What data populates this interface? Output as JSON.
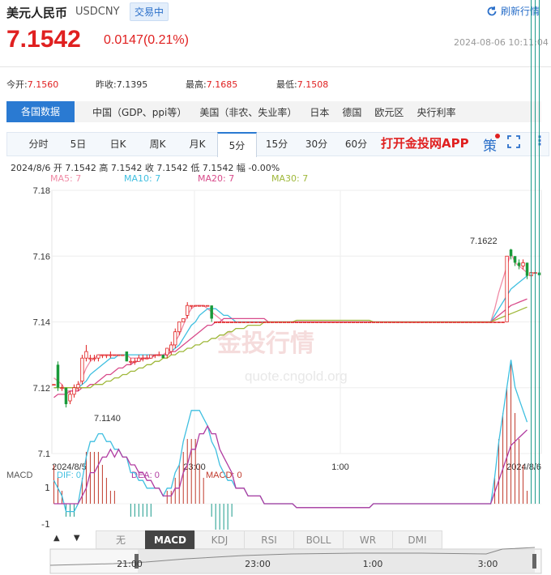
{
  "header": {
    "name": "美元人民币",
    "code": "USDCNY",
    "status": "交易中",
    "refresh_label": "刷新行情",
    "price": "7.1542",
    "change": "0.0147(0.21%)",
    "timestamp": "2024-08-06 10:11:04"
  },
  "stats": [
    {
      "label": "今开:",
      "value": "7.1560"
    },
    {
      "label": "昨收:",
      "value": "7.1395"
    },
    {
      "label": "最高:",
      "value": "7.1685"
    },
    {
      "label": "最低:",
      "value": "7.1508"
    }
  ],
  "data_tabs": [
    "各国数据",
    "中国（GDP、ppi等）",
    "美国（非农、失业率）",
    "日本",
    "德国",
    "欧元区",
    "央行利率"
  ],
  "period_tabs": [
    "分时",
    "5日",
    "日K",
    "周K",
    "月K",
    "5分",
    "15分",
    "30分",
    "60分"
  ],
  "active_period": "5分",
  "app_link": "打开金投网APP",
  "ce_label": "策",
  "info_line": "2024/8/6  开 7.1542  高 7.1542  收 7.1542  低 7.1542  幅 -0.00%",
  "ma": [
    {
      "label": "MA5: 7",
      "color": "#f08aa5"
    },
    {
      "label": "MA10: 7",
      "color": "#3fbfe0"
    },
    {
      "label": "MA20: 7",
      "color": "#d84a8a"
    },
    {
      "label": "MA30: 7",
      "color": "#9fb83a"
    }
  ],
  "watermark": {
    "cn": "金投行情",
    "url": "quote.cngold.org"
  },
  "macd_legend": [
    {
      "label": "MACD",
      "color": "#555"
    },
    {
      "label": "DIF: 0",
      "color": "#3fbfe0"
    },
    {
      "label": "DEA: 0",
      "color": "#b03aa0"
    },
    {
      "label": "MACD: 0",
      "color": "#c0392b"
    }
  ],
  "indicator_tabs": [
    "无",
    "MACD",
    "KDJ",
    "RSI",
    "BOLL",
    "WR",
    "DMI"
  ],
  "active_indicator": "MACD",
  "nav_labels": [
    "21:00",
    "23:00",
    "1:00",
    "3:00"
  ],
  "arrows": [
    "▲",
    "▼"
  ],
  "chart_data": {
    "type": "candlestick",
    "ylim": [
      7.1,
      7.18
    ],
    "y_ticks": [
      "7.18",
      "7.16",
      "7.14",
      "7.12",
      "7.1"
    ],
    "x_ticks": [
      "2024/8/5",
      "23:00",
      "1:00",
      "2024/8/6"
    ],
    "annotations": [
      "7.1140",
      "7.1622"
    ],
    "candles": [
      [
        7.121,
        7.121,
        7.12,
        7.12
      ],
      [
        7.127,
        7.12,
        7.128,
        7.119
      ],
      [
        7.12,
        7.12,
        7.121,
        7.119
      ],
      [
        7.12,
        7.115,
        7.12,
        7.114
      ],
      [
        7.116,
        7.118,
        7.119,
        7.115
      ],
      [
        7.118,
        7.12,
        7.121,
        7.117
      ],
      [
        7.12,
        7.121,
        7.122,
        7.119
      ],
      [
        7.122,
        7.129,
        7.13,
        7.121
      ],
      [
        7.129,
        7.131,
        7.133,
        7.128
      ],
      [
        7.129,
        7.129,
        7.13,
        7.128
      ],
      [
        7.129,
        7.129,
        7.13,
        7.128
      ],
      [
        7.129,
        7.13,
        7.13,
        7.128
      ],
      [
        7.13,
        7.13,
        7.13,
        7.129
      ],
      [
        7.13,
        7.13,
        7.13,
        7.129
      ],
      [
        7.13,
        7.13,
        7.131,
        7.129
      ],
      [
        7.13,
        7.13,
        7.13,
        7.13
      ],
      [
        7.13,
        7.13,
        7.13,
        7.13
      ],
      [
        7.13,
        7.13,
        7.13,
        7.13
      ],
      [
        7.131,
        7.128,
        7.131,
        7.128
      ],
      [
        7.128,
        7.128,
        7.129,
        7.127
      ],
      [
        7.128,
        7.128,
        7.129,
        7.127
      ],
      [
        7.128,
        7.129,
        7.13,
        7.128
      ],
      [
        7.129,
        7.129,
        7.13,
        7.128
      ],
      [
        7.129,
        7.129,
        7.13,
        7.129
      ],
      [
        7.129,
        7.13,
        7.13,
        7.129
      ],
      [
        7.13,
        7.13,
        7.13,
        7.129
      ],
      [
        7.13,
        7.13,
        7.131,
        7.13
      ],
      [
        7.13,
        7.129,
        7.13,
        7.129
      ],
      [
        7.13,
        7.132,
        7.132,
        7.129
      ],
      [
        7.131,
        7.133,
        7.134,
        7.13
      ],
      [
        7.133,
        7.137,
        7.138,
        7.132
      ],
      [
        7.137,
        7.14,
        7.14,
        7.136
      ],
      [
        7.14,
        7.141,
        7.141,
        7.14
      ],
      [
        7.142,
        7.145,
        7.146,
        7.141
      ],
      [
        7.145,
        7.145,
        7.145,
        7.144
      ],
      [
        7.145,
        7.145,
        7.145,
        7.145
      ],
      [
        7.145,
        7.145,
        7.145,
        7.145
      ],
      [
        7.145,
        7.145,
        7.145,
        7.145
      ],
      [
        7.145,
        7.145,
        7.145,
        7.145
      ],
      [
        7.145,
        7.141,
        7.145,
        7.14
      ],
      [
        7.14,
        7.14,
        7.14,
        7.14
      ],
      [
        7.14,
        7.14,
        7.14,
        7.14
      ],
      [
        7.14,
        7.14,
        7.14,
        7.14
      ],
      [
        7.14,
        7.14,
        7.14,
        7.14
      ],
      [
        7.14,
        7.14,
        7.14,
        7.14
      ],
      [
        7.14,
        7.14,
        7.14,
        7.14
      ],
      [
        7.14,
        7.14,
        7.14,
        7.14
      ],
      [
        7.14,
        7.14,
        7.14,
        7.14
      ],
      [
        7.14,
        7.14,
        7.14,
        7.14
      ],
      [
        7.14,
        7.14,
        7.14,
        7.14
      ],
      [
        7.14,
        7.14,
        7.14,
        7.14
      ],
      [
        7.14,
        7.14,
        7.14,
        7.14
      ],
      [
        7.14,
        7.14,
        7.14,
        7.14
      ],
      [
        7.14,
        7.14,
        7.14,
        7.14
      ],
      [
        7.14,
        7.14,
        7.14,
        7.14
      ],
      [
        7.14,
        7.14,
        7.14,
        7.14
      ],
      [
        7.14,
        7.14,
        7.14,
        7.14
      ],
      [
        7.14,
        7.14,
        7.14,
        7.14
      ],
      [
        7.14,
        7.14,
        7.14,
        7.14
      ],
      [
        7.14,
        7.14,
        7.14,
        7.14
      ],
      [
        7.14,
        7.14,
        7.14,
        7.14
      ],
      [
        7.14,
        7.14,
        7.14,
        7.14
      ],
      [
        7.14,
        7.14,
        7.14,
        7.14
      ],
      [
        7.14,
        7.14,
        7.14,
        7.14
      ],
      [
        7.14,
        7.14,
        7.14,
        7.14
      ],
      [
        7.14,
        7.14,
        7.14,
        7.14
      ],
      [
        7.14,
        7.14,
        7.14,
        7.14
      ],
      [
        7.14,
        7.14,
        7.14,
        7.14
      ],
      [
        7.14,
        7.14,
        7.14,
        7.14
      ],
      [
        7.14,
        7.14,
        7.14,
        7.14
      ],
      [
        7.14,
        7.14,
        7.14,
        7.14
      ],
      [
        7.14,
        7.14,
        7.14,
        7.14
      ],
      [
        7.14,
        7.14,
        7.14,
        7.14
      ],
      [
        7.14,
        7.14,
        7.14,
        7.14
      ],
      [
        7.14,
        7.14,
        7.14,
        7.14
      ],
      [
        7.14,
        7.14,
        7.14,
        7.14
      ],
      [
        7.14,
        7.14,
        7.14,
        7.14
      ],
      [
        7.14,
        7.14,
        7.14,
        7.14
      ],
      [
        7.14,
        7.14,
        7.14,
        7.14
      ],
      [
        7.14,
        7.14,
        7.14,
        7.14
      ],
      [
        7.14,
        7.14,
        7.14,
        7.14
      ],
      [
        7.14,
        7.14,
        7.14,
        7.14
      ],
      [
        7.14,
        7.14,
        7.14,
        7.14
      ],
      [
        7.14,
        7.14,
        7.14,
        7.14
      ],
      [
        7.14,
        7.14,
        7.14,
        7.14
      ],
      [
        7.14,
        7.14,
        7.14,
        7.14
      ],
      [
        7.14,
        7.14,
        7.14,
        7.14
      ],
      [
        7.14,
        7.14,
        7.14,
        7.14
      ],
      [
        7.14,
        7.14,
        7.14,
        7.14
      ],
      [
        7.14,
        7.14,
        7.14,
        7.14
      ],
      [
        7.14,
        7.14,
        7.14,
        7.14
      ],
      [
        7.14,
        7.14,
        7.14,
        7.14
      ],
      [
        7.14,
        7.14,
        7.14,
        7.14
      ],
      [
        7.14,
        7.14,
        7.14,
        7.14
      ],
      [
        7.14,
        7.14,
        7.14,
        7.14
      ],
      [
        7.14,
        7.14,
        7.14,
        7.14
      ],
      [
        7.14,
        7.14,
        7.14,
        7.14
      ],
      [
        7.14,
        7.14,
        7.14,
        7.14
      ],
      [
        7.14,
        7.14,
        7.14,
        7.14
      ],
      [
        7.14,
        7.14,
        7.14,
        7.14
      ],
      [
        7.14,
        7.14,
        7.14,
        7.14
      ],
      [
        7.14,
        7.14,
        7.14,
        7.14
      ],
      [
        7.14,
        7.14,
        7.14,
        7.14
      ],
      [
        7.14,
        7.14,
        7.14,
        7.14
      ],
      [
        7.14,
        7.14,
        7.14,
        7.14
      ],
      [
        7.14,
        7.14,
        7.14,
        7.14
      ],
      [
        7.14,
        7.14,
        7.14,
        7.14
      ],
      [
        7.14,
        7.14,
        7.14,
        7.14
      ],
      [
        7.14,
        7.14,
        7.14,
        7.14
      ],
      [
        7.14,
        7.14,
        7.14,
        7.14
      ],
      [
        7.14,
        7.14,
        7.14,
        7.14
      ],
      [
        7.14,
        7.14,
        7.14,
        7.14
      ],
      [
        7.14,
        7.16,
        7.16,
        7.14
      ],
      [
        7.162,
        7.16,
        7.1622,
        7.159
      ],
      [
        7.16,
        7.158,
        7.16,
        7.157
      ],
      [
        7.158,
        7.157,
        7.159,
        7.156
      ],
      [
        7.157,
        7.158,
        7.159,
        7.156
      ],
      [
        7.158,
        7.154,
        7.158,
        7.153
      ],
      [
        7.154,
        7.155,
        7.156,
        7.153
      ],
      [
        7.155,
        7.155,
        7.156,
        7.154
      ],
      [
        7.155,
        7.1542,
        7.155,
        7.154
      ]
    ],
    "series": [
      {
        "name": "MA5",
        "color": "#f08aa5",
        "values": [
          7.123,
          7.122,
          7.121,
          7.119,
          7.119,
          7.119,
          7.12,
          7.123,
          7.126,
          7.128,
          7.129,
          7.13,
          7.13,
          7.13,
          7.13,
          7.13,
          7.13,
          7.13,
          7.13,
          7.129,
          7.129,
          7.129,
          7.129,
          7.129,
          7.129,
          7.13,
          7.13,
          7.13,
          7.131,
          7.132,
          7.134,
          7.136,
          7.139,
          7.142,
          7.144,
          7.145,
          7.145,
          7.145,
          7.144,
          7.143,
          7.142,
          7.141,
          7.14,
          7.14,
          7.14,
          7.14,
          7.14,
          7.14,
          7.14,
          7.14,
          7.14,
          7.14,
          7.14,
          7.14,
          7.14,
          7.14,
          7.14,
          7.14,
          7.14,
          7.14,
          7.14,
          7.14,
          7.14,
          7.14,
          7.14,
          7.14,
          7.14,
          7.14,
          7.14,
          7.14,
          7.14,
          7.14,
          7.14,
          7.14,
          7.14,
          7.14,
          7.14,
          7.14,
          7.14,
          7.14,
          7.14,
          7.14,
          7.14,
          7.14,
          7.14,
          7.14,
          7.14,
          7.14,
          7.14,
          7.14,
          7.14,
          7.14,
          7.14,
          7.14,
          7.14,
          7.14,
          7.14,
          7.14,
          7.14,
          7.14,
          7.14,
          7.14,
          7.14,
          7.14,
          7.14,
          7.14,
          7.14,
          7.14,
          7.14,
          7.144,
          7.149,
          7.153,
          7.157,
          7.161,
          7.158,
          7.157,
          7.156,
          7.155
        ]
      },
      {
        "name": "MA10",
        "color": "#3fbfe0",
        "values": [
          7.12,
          7.12,
          7.12,
          7.12,
          7.12,
          7.12,
          7.12,
          7.121,
          7.122,
          7.124,
          7.125,
          7.126,
          7.127,
          7.128,
          7.129,
          7.129,
          7.13,
          7.13,
          7.13,
          7.13,
          7.13,
          7.13,
          7.13,
          7.13,
          7.13,
          7.13,
          7.13,
          7.13,
          7.13,
          7.131,
          7.132,
          7.133,
          7.135,
          7.137,
          7.139,
          7.14,
          7.142,
          7.143,
          7.144,
          7.144,
          7.144,
          7.143,
          7.142,
          7.142,
          7.141,
          7.14,
          7.14,
          7.14,
          7.14,
          7.14,
          7.14,
          7.14,
          7.14,
          7.14,
          7.14,
          7.14,
          7.14,
          7.14,
          7.14,
          7.14,
          7.14,
          7.14,
          7.14,
          7.14,
          7.14,
          7.14,
          7.14,
          7.14,
          7.14,
          7.14,
          7.14,
          7.14,
          7.14,
          7.14,
          7.14,
          7.14,
          7.14,
          7.14,
          7.14,
          7.14,
          7.14,
          7.14,
          7.14,
          7.14,
          7.14,
          7.14,
          7.14,
          7.14,
          7.14,
          7.14,
          7.14,
          7.14,
          7.14,
          7.14,
          7.14,
          7.14,
          7.14,
          7.14,
          7.14,
          7.14,
          7.14,
          7.14,
          7.14,
          7.14,
          7.14,
          7.14,
          7.14,
          7.14,
          7.14,
          7.142,
          7.144,
          7.146,
          7.148,
          7.15,
          7.151,
          7.152,
          7.153,
          7.154
        ]
      },
      {
        "name": "MA20",
        "color": "#d84a8a",
        "values": [
          7.117,
          7.118,
          7.118,
          7.118,
          7.119,
          7.119,
          7.119,
          7.12,
          7.12,
          7.121,
          7.121,
          7.122,
          7.123,
          7.124,
          7.124,
          7.125,
          7.126,
          7.126,
          7.127,
          7.127,
          7.128,
          7.128,
          7.129,
          7.129,
          7.129,
          7.13,
          7.13,
          7.13,
          7.13,
          7.131,
          7.131,
          7.132,
          7.133,
          7.134,
          7.135,
          7.136,
          7.137,
          7.138,
          7.139,
          7.139,
          7.14,
          7.14,
          7.141,
          7.141,
          7.141,
          7.141,
          7.141,
          7.141,
          7.141,
          7.141,
          7.141,
          7.141,
          7.141,
          7.14,
          7.14,
          7.14,
          7.14,
          7.14,
          7.14,
          7.14,
          7.14,
          7.14,
          7.14,
          7.14,
          7.14,
          7.14,
          7.14,
          7.14,
          7.14,
          7.14,
          7.14,
          7.14,
          7.14,
          7.14,
          7.14,
          7.14,
          7.14,
          7.14,
          7.14,
          7.14,
          7.14,
          7.14,
          7.14,
          7.14,
          7.14,
          7.14,
          7.14,
          7.14,
          7.14,
          7.14,
          7.14,
          7.14,
          7.14,
          7.14,
          7.14,
          7.14,
          7.14,
          7.14,
          7.14,
          7.14,
          7.14,
          7.14,
          7.14,
          7.14,
          7.14,
          7.14,
          7.14,
          7.14,
          7.14,
          7.141,
          7.142,
          7.143,
          7.144,
          7.145,
          7.1455,
          7.146,
          7.1465,
          7.147
        ]
      },
      {
        "name": "MA30",
        "color": "#9fb83a",
        "values": [
          7.12,
          7.12,
          7.12,
          7.12,
          7.12,
          7.12,
          7.12,
          7.12,
          7.12,
          7.12,
          7.121,
          7.121,
          7.121,
          7.122,
          7.122,
          7.123,
          7.123,
          7.124,
          7.124,
          7.125,
          7.125,
          7.126,
          7.126,
          7.127,
          7.127,
          7.128,
          7.128,
          7.129,
          7.129,
          7.13,
          7.13,
          7.131,
          7.131,
          7.132,
          7.132,
          7.133,
          7.133,
          7.134,
          7.134,
          7.135,
          7.135,
          7.136,
          7.136,
          7.137,
          7.137,
          7.138,
          7.138,
          7.138,
          7.139,
          7.139,
          7.139,
          7.139,
          7.14,
          7.14,
          7.14,
          7.14,
          7.14,
          7.14,
          7.14,
          7.14,
          7.1405,
          7.1405,
          7.1405,
          7.1405,
          7.1405,
          7.1405,
          7.1405,
          7.1405,
          7.1405,
          7.1405,
          7.1405,
          7.1405,
          7.1405,
          7.1405,
          7.1405,
          7.1405,
          7.1405,
          7.1405,
          7.1405,
          7.14,
          7.14,
          7.14,
          7.14,
          7.14,
          7.14,
          7.14,
          7.14,
          7.14,
          7.14,
          7.14,
          7.14,
          7.14,
          7.14,
          7.14,
          7.14,
          7.14,
          7.14,
          7.14,
          7.14,
          7.14,
          7.14,
          7.14,
          7.14,
          7.14,
          7.14,
          7.14,
          7.14,
          7.14,
          7.14,
          7.1405,
          7.141,
          7.1415,
          7.142,
          7.1425,
          7.143,
          7.1435,
          7.144,
          7.1445
        ]
      }
    ]
  }
}
